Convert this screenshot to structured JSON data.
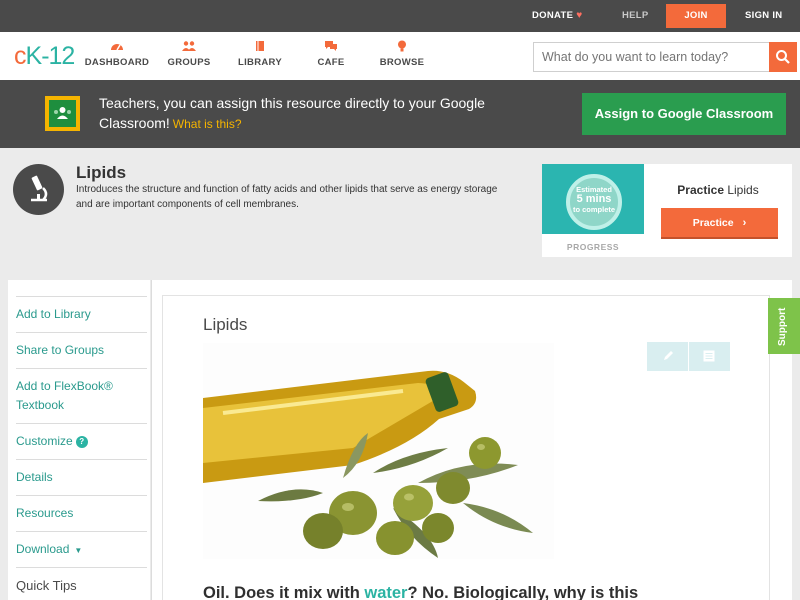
{
  "topbar": {
    "donate": "DONATE",
    "help": "HELP",
    "join": "JOIN",
    "signin": "SIGN IN"
  },
  "nav": {
    "logo_c": "c",
    "logo_k": "K",
    "logo_num": "-12",
    "items": [
      {
        "label": "DASHBOARD",
        "icon": "dashboard-icon"
      },
      {
        "label": "GROUPS",
        "icon": "groups-icon"
      },
      {
        "label": "LIBRARY",
        "icon": "library-icon"
      },
      {
        "label": "CAFE",
        "icon": "cafe-icon"
      },
      {
        "label": "BROWSE",
        "icon": "browse-icon"
      }
    ],
    "search_placeholder": "What do you want to learn today?"
  },
  "classroom_banner": {
    "text": "Teachers, you can assign this resource directly to your Google Classroom!",
    "what_link": "What is this?",
    "assign_button": "Assign to Google Classroom"
  },
  "concept": {
    "title": "Lipids",
    "description": "Introduces the structure and function of fatty acids and other lipids that serve as energy storage and are important components of cell membranes.",
    "icon": "microscope-icon"
  },
  "practice_card": {
    "estimated": "Estimated",
    "mins": "5 mins",
    "to_complete": "to complete",
    "progress_label": "PROGRESS",
    "practice_bold": "Practice",
    "practice_topic": "Lipids",
    "practice_button": "Practice"
  },
  "sidebar": {
    "items": [
      {
        "label": "Add to Library"
      },
      {
        "label": "Share to Groups"
      },
      {
        "label": "Add to FlexBook® Textbook"
      },
      {
        "label": "Customize"
      },
      {
        "label": "Details"
      },
      {
        "label": "Resources"
      },
      {
        "label": "Download"
      },
      {
        "label": "Quick Tips"
      }
    ]
  },
  "lesson": {
    "title": "Lipids",
    "text_before": "Oil. Does it mix with ",
    "text_link": "water",
    "text_after": "? No. Biologically, why is this"
  },
  "support_tab": "Support",
  "colors": {
    "accent_orange": "#f36a3b",
    "accent_teal": "#2bb3a3",
    "dark_bar": "#4a4a4a",
    "classroom_green": "#2a9d4f",
    "support_green": "#7ec34a"
  }
}
